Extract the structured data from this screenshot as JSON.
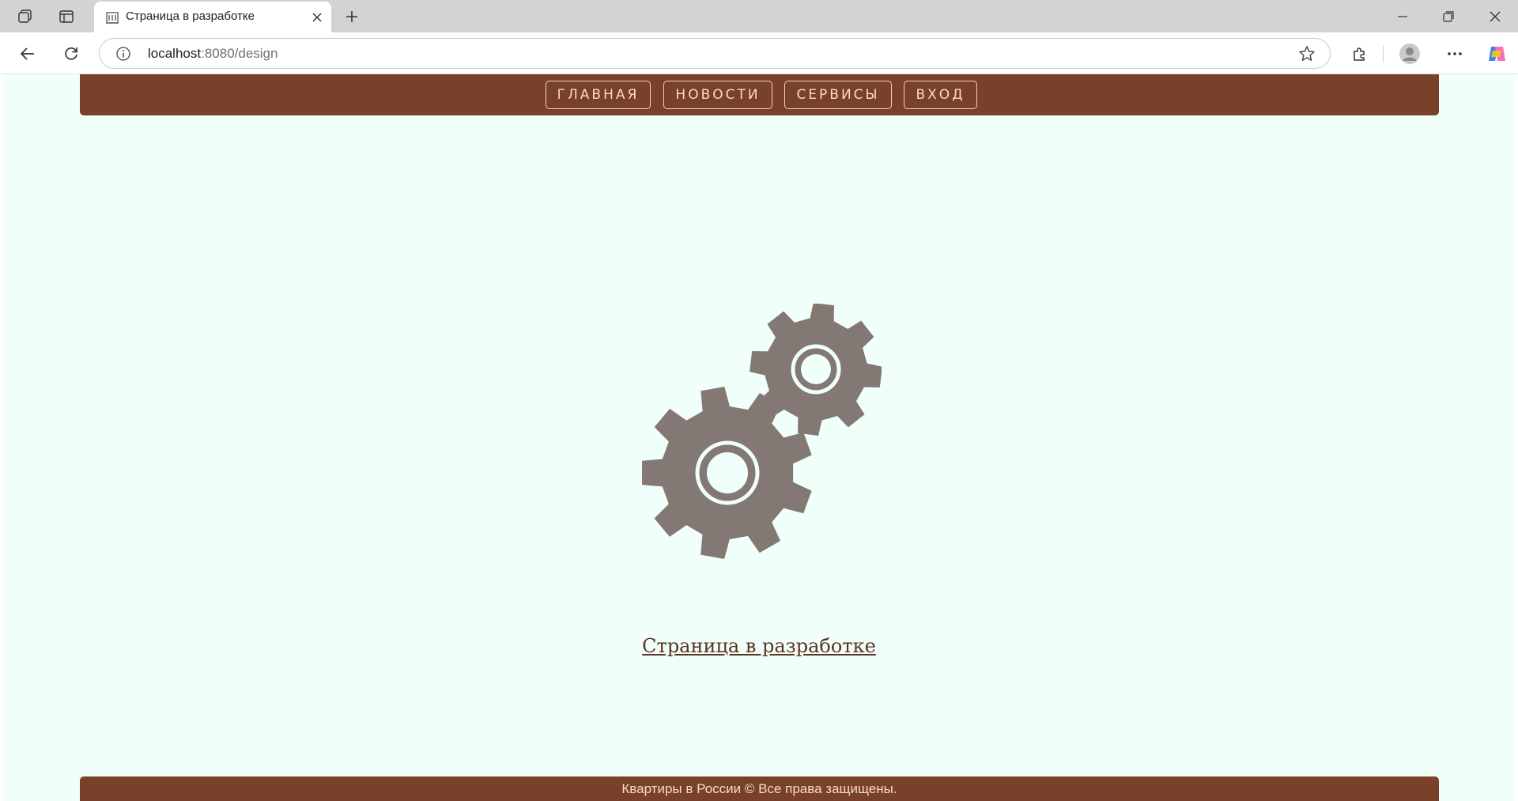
{
  "browser": {
    "tab": {
      "title": "Страница в разработке",
      "favicon": "building-icon"
    },
    "url_host": "localhost",
    "url_path": ":8080/design"
  },
  "nav": {
    "items": [
      {
        "label": "ГЛАВНАЯ"
      },
      {
        "label": "НОВОСТИ"
      },
      {
        "label": "СЕРВИСЫ"
      },
      {
        "label": "ВХОД"
      }
    ]
  },
  "main": {
    "illustration": "gears-icon",
    "link_text": "Страница в разработке"
  },
  "footer": {
    "text": "Квартиры в России © Все права защищены."
  },
  "colors": {
    "brand": "#79402a",
    "page_background": "#f1fffa",
    "gear": "#837874",
    "nav_text": "#f6dcc0"
  }
}
